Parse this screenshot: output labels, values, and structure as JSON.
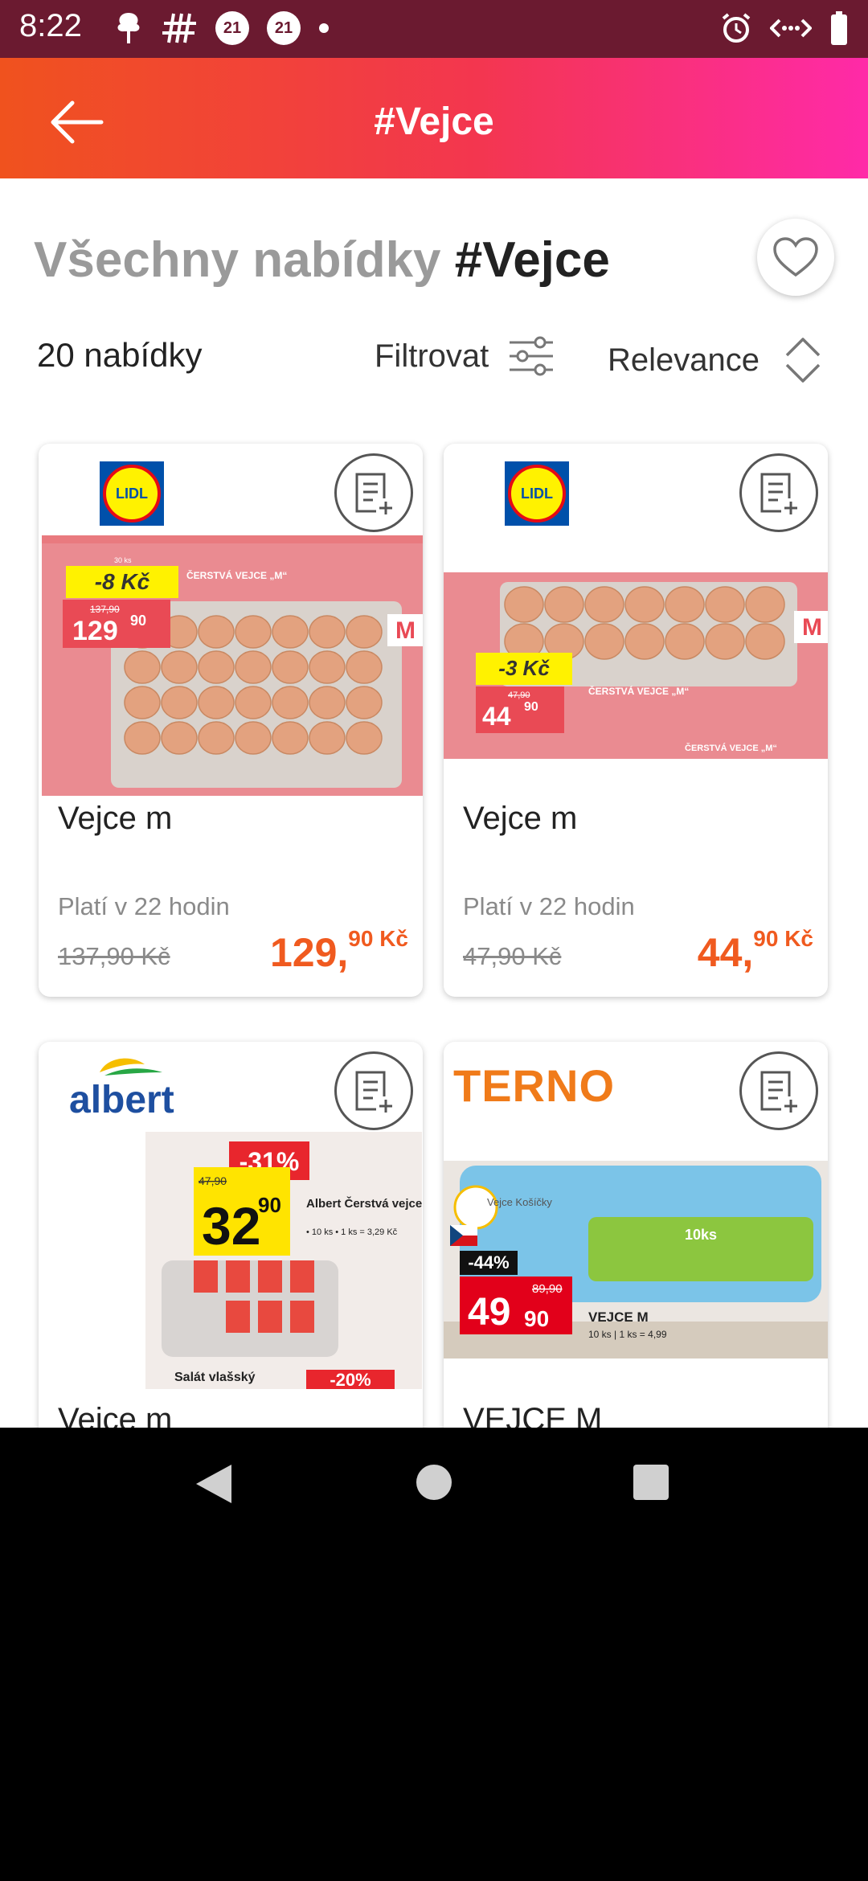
{
  "status_bar": {
    "time": "8:22",
    "badge_1": "21",
    "badge_2": "21"
  },
  "app_bar": {
    "title": "#Vejce"
  },
  "header": {
    "title_muted": "Všechny nabídky",
    "title_tag": "#Vejce",
    "count": "20 nabídky",
    "filter_label": "Filtrovat",
    "sort_label": "Relevance"
  },
  "offers": [
    {
      "store": "LIDL",
      "name": "Vejce m",
      "validity": "Platí v 22 hodin",
      "old_price": "137,90 Kč",
      "price_main": "129,",
      "price_cents": "90 Kč",
      "flyer": {
        "discount": "-8 Kč",
        "old": "137,90",
        "price_main": "129",
        "price_cents": "90",
        "title": "ČERSTVÁ VEJCE „M“",
        "pack": "30 ks",
        "letter": "M"
      }
    },
    {
      "store": "LIDL",
      "name": "Vejce m",
      "validity": "Platí v 22 hodin",
      "old_price": "47,90 Kč",
      "price_main": "44,",
      "price_cents": "90 Kč",
      "flyer": {
        "discount": "-3 Kč",
        "old": "47,90",
        "price_main": "44",
        "price_cents": "90",
        "title": "ČERSTVÁ VEJCE „M“",
        "footer": "ČERSTVÁ VEJCE „M“",
        "letter": "M"
      }
    },
    {
      "store": "albert",
      "name": "Vejce m",
      "flyer": {
        "discount": "-31%",
        "old": "47,90",
        "price_main": "32",
        "price_cents": "90",
        "title": "Albert Čerstvá vejce M",
        "sub": "• 10 ks • 1 ks = 3,29 Kč",
        "bottom": "Salát vlašský",
        "bottom_badge": "-20%"
      }
    },
    {
      "store": "TERNO",
      "name": "VEJCE M",
      "flyer": {
        "brand": "Vejce Košíčky",
        "discount": "-44%",
        "old": "89,90",
        "price_main": "49",
        "price_cents": "90",
        "title": "VEJCE M",
        "sub": "10 ks | 1 ks = 4,99",
        "pack": "10ks"
      }
    }
  ],
  "colors": {
    "accent": "#f05a1f",
    "gradient_start": "#f0521e",
    "gradient_end": "#ff2aa8",
    "status_bar": "#6b1a30"
  }
}
